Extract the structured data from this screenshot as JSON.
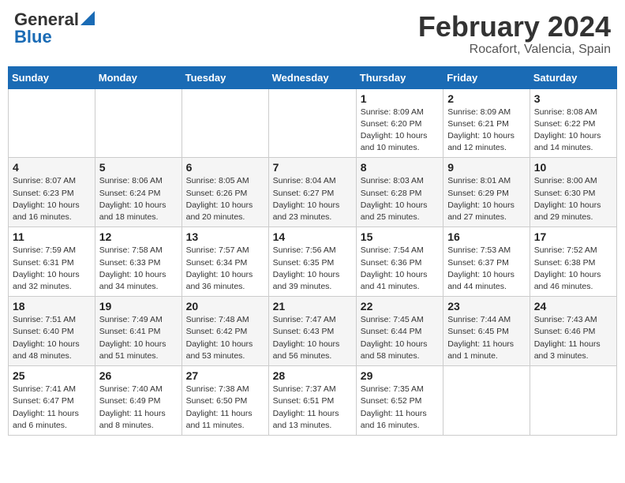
{
  "header": {
    "logo_general": "General",
    "logo_blue": "Blue",
    "month_year": "February 2024",
    "location": "Rocafort, Valencia, Spain"
  },
  "weekdays": [
    "Sunday",
    "Monday",
    "Tuesday",
    "Wednesday",
    "Thursday",
    "Friday",
    "Saturday"
  ],
  "weeks": [
    [
      {
        "day": "",
        "info": ""
      },
      {
        "day": "",
        "info": ""
      },
      {
        "day": "",
        "info": ""
      },
      {
        "day": "",
        "info": ""
      },
      {
        "day": "1",
        "info": "Sunrise: 8:09 AM\nSunset: 6:20 PM\nDaylight: 10 hours\nand 10 minutes."
      },
      {
        "day": "2",
        "info": "Sunrise: 8:09 AM\nSunset: 6:21 PM\nDaylight: 10 hours\nand 12 minutes."
      },
      {
        "day": "3",
        "info": "Sunrise: 8:08 AM\nSunset: 6:22 PM\nDaylight: 10 hours\nand 14 minutes."
      }
    ],
    [
      {
        "day": "4",
        "info": "Sunrise: 8:07 AM\nSunset: 6:23 PM\nDaylight: 10 hours\nand 16 minutes."
      },
      {
        "day": "5",
        "info": "Sunrise: 8:06 AM\nSunset: 6:24 PM\nDaylight: 10 hours\nand 18 minutes."
      },
      {
        "day": "6",
        "info": "Sunrise: 8:05 AM\nSunset: 6:26 PM\nDaylight: 10 hours\nand 20 minutes."
      },
      {
        "day": "7",
        "info": "Sunrise: 8:04 AM\nSunset: 6:27 PM\nDaylight: 10 hours\nand 23 minutes."
      },
      {
        "day": "8",
        "info": "Sunrise: 8:03 AM\nSunset: 6:28 PM\nDaylight: 10 hours\nand 25 minutes."
      },
      {
        "day": "9",
        "info": "Sunrise: 8:01 AM\nSunset: 6:29 PM\nDaylight: 10 hours\nand 27 minutes."
      },
      {
        "day": "10",
        "info": "Sunrise: 8:00 AM\nSunset: 6:30 PM\nDaylight: 10 hours\nand 29 minutes."
      }
    ],
    [
      {
        "day": "11",
        "info": "Sunrise: 7:59 AM\nSunset: 6:31 PM\nDaylight: 10 hours\nand 32 minutes."
      },
      {
        "day": "12",
        "info": "Sunrise: 7:58 AM\nSunset: 6:33 PM\nDaylight: 10 hours\nand 34 minutes."
      },
      {
        "day": "13",
        "info": "Sunrise: 7:57 AM\nSunset: 6:34 PM\nDaylight: 10 hours\nand 36 minutes."
      },
      {
        "day": "14",
        "info": "Sunrise: 7:56 AM\nSunset: 6:35 PM\nDaylight: 10 hours\nand 39 minutes."
      },
      {
        "day": "15",
        "info": "Sunrise: 7:54 AM\nSunset: 6:36 PM\nDaylight: 10 hours\nand 41 minutes."
      },
      {
        "day": "16",
        "info": "Sunrise: 7:53 AM\nSunset: 6:37 PM\nDaylight: 10 hours\nand 44 minutes."
      },
      {
        "day": "17",
        "info": "Sunrise: 7:52 AM\nSunset: 6:38 PM\nDaylight: 10 hours\nand 46 minutes."
      }
    ],
    [
      {
        "day": "18",
        "info": "Sunrise: 7:51 AM\nSunset: 6:40 PM\nDaylight: 10 hours\nand 48 minutes."
      },
      {
        "day": "19",
        "info": "Sunrise: 7:49 AM\nSunset: 6:41 PM\nDaylight: 10 hours\nand 51 minutes."
      },
      {
        "day": "20",
        "info": "Sunrise: 7:48 AM\nSunset: 6:42 PM\nDaylight: 10 hours\nand 53 minutes."
      },
      {
        "day": "21",
        "info": "Sunrise: 7:47 AM\nSunset: 6:43 PM\nDaylight: 10 hours\nand 56 minutes."
      },
      {
        "day": "22",
        "info": "Sunrise: 7:45 AM\nSunset: 6:44 PM\nDaylight: 10 hours\nand 58 minutes."
      },
      {
        "day": "23",
        "info": "Sunrise: 7:44 AM\nSunset: 6:45 PM\nDaylight: 11 hours\nand 1 minute."
      },
      {
        "day": "24",
        "info": "Sunrise: 7:43 AM\nSunset: 6:46 PM\nDaylight: 11 hours\nand 3 minutes."
      }
    ],
    [
      {
        "day": "25",
        "info": "Sunrise: 7:41 AM\nSunset: 6:47 PM\nDaylight: 11 hours\nand 6 minutes."
      },
      {
        "day": "26",
        "info": "Sunrise: 7:40 AM\nSunset: 6:49 PM\nDaylight: 11 hours\nand 8 minutes."
      },
      {
        "day": "27",
        "info": "Sunrise: 7:38 AM\nSunset: 6:50 PM\nDaylight: 11 hours\nand 11 minutes."
      },
      {
        "day": "28",
        "info": "Sunrise: 7:37 AM\nSunset: 6:51 PM\nDaylight: 11 hours\nand 13 minutes."
      },
      {
        "day": "29",
        "info": "Sunrise: 7:35 AM\nSunset: 6:52 PM\nDaylight: 11 hours\nand 16 minutes."
      },
      {
        "day": "",
        "info": ""
      },
      {
        "day": "",
        "info": ""
      }
    ]
  ]
}
